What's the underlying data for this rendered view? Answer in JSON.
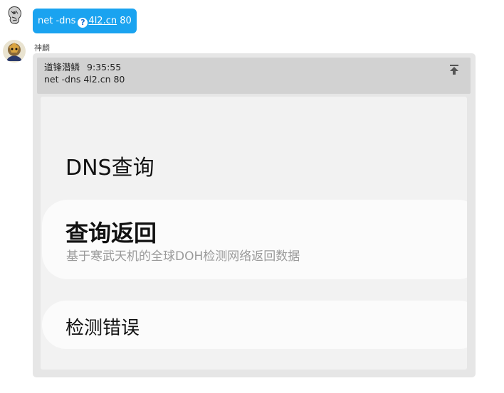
{
  "messages": {
    "user_command": {
      "prefix": "net -dns",
      "link": "4l2.cn",
      "suffix": "80"
    },
    "bot": {
      "sender_name": "神麟",
      "quote": {
        "author": "道锋潜鳞",
        "time": "9:35:55",
        "text": "net -dns 4l2.cn 80"
      },
      "card": {
        "title": "DNS查询",
        "result_heading": "查询返回",
        "result_subtitle": "基于寒武天机的全球DOH检测网络返回数据",
        "error_heading": "检测错误"
      }
    }
  },
  "icons": {
    "help": "question-circle-icon",
    "pin": "pin-to-top-icon"
  },
  "colors": {
    "user_bubble": "#1aa3f0",
    "card_background": "#e6e6e6",
    "quote_background": "#d2d2d2"
  }
}
